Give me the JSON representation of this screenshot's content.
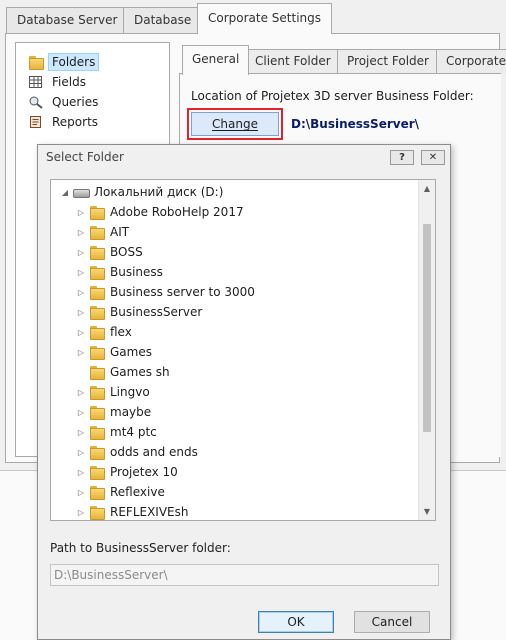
{
  "top_tabs": [
    "Database Server",
    "Database",
    "Corporate Settings"
  ],
  "tree": {
    "items": [
      {
        "label": "Folders",
        "icon": "folder-icon",
        "selected": true
      },
      {
        "label": "Fields",
        "icon": "fields-grid-icon",
        "selected": false
      },
      {
        "label": "Queries",
        "icon": "queries-icon",
        "selected": false
      },
      {
        "label": "Reports",
        "icon": "reports-icon",
        "selected": false
      }
    ]
  },
  "inner_tabs": [
    "General",
    "Client Folder",
    "Project Folder",
    "Corporate"
  ],
  "general": {
    "location_label": "Location of Projetex 3D server Business Folder:",
    "change_button": "Change",
    "current_path": "D:\\BusinessServer\\"
  },
  "dialog": {
    "title": "Select Folder",
    "help_glyph": "?",
    "close_glyph": "✕",
    "drive_label": "Локальний диск (D:)",
    "folders": [
      "Adobe RoboHelp 2017",
      "AIT",
      "BOSS",
      "Business",
      "Business server to 3000",
      "BusinessServer",
      "flex",
      "Games",
      "Games sh",
      "Lingvo",
      "maybe",
      "mt4 ptc",
      "odds and ends",
      "Projetex 10",
      "Reflexive",
      "REFLEXIVEsh"
    ],
    "expandable": [
      true,
      true,
      true,
      true,
      true,
      true,
      true,
      true,
      false,
      true,
      true,
      true,
      true,
      true,
      true,
      true
    ],
    "path_label": "Path to BusinessServer folder:",
    "path_value": "D:\\BusinessServer\\",
    "ok_label": "OK",
    "cancel_label": "Cancel"
  },
  "colors": {
    "highlight_border": "#e0242c",
    "path_text": "#0b1c6e",
    "selection": "#cce8ff"
  }
}
